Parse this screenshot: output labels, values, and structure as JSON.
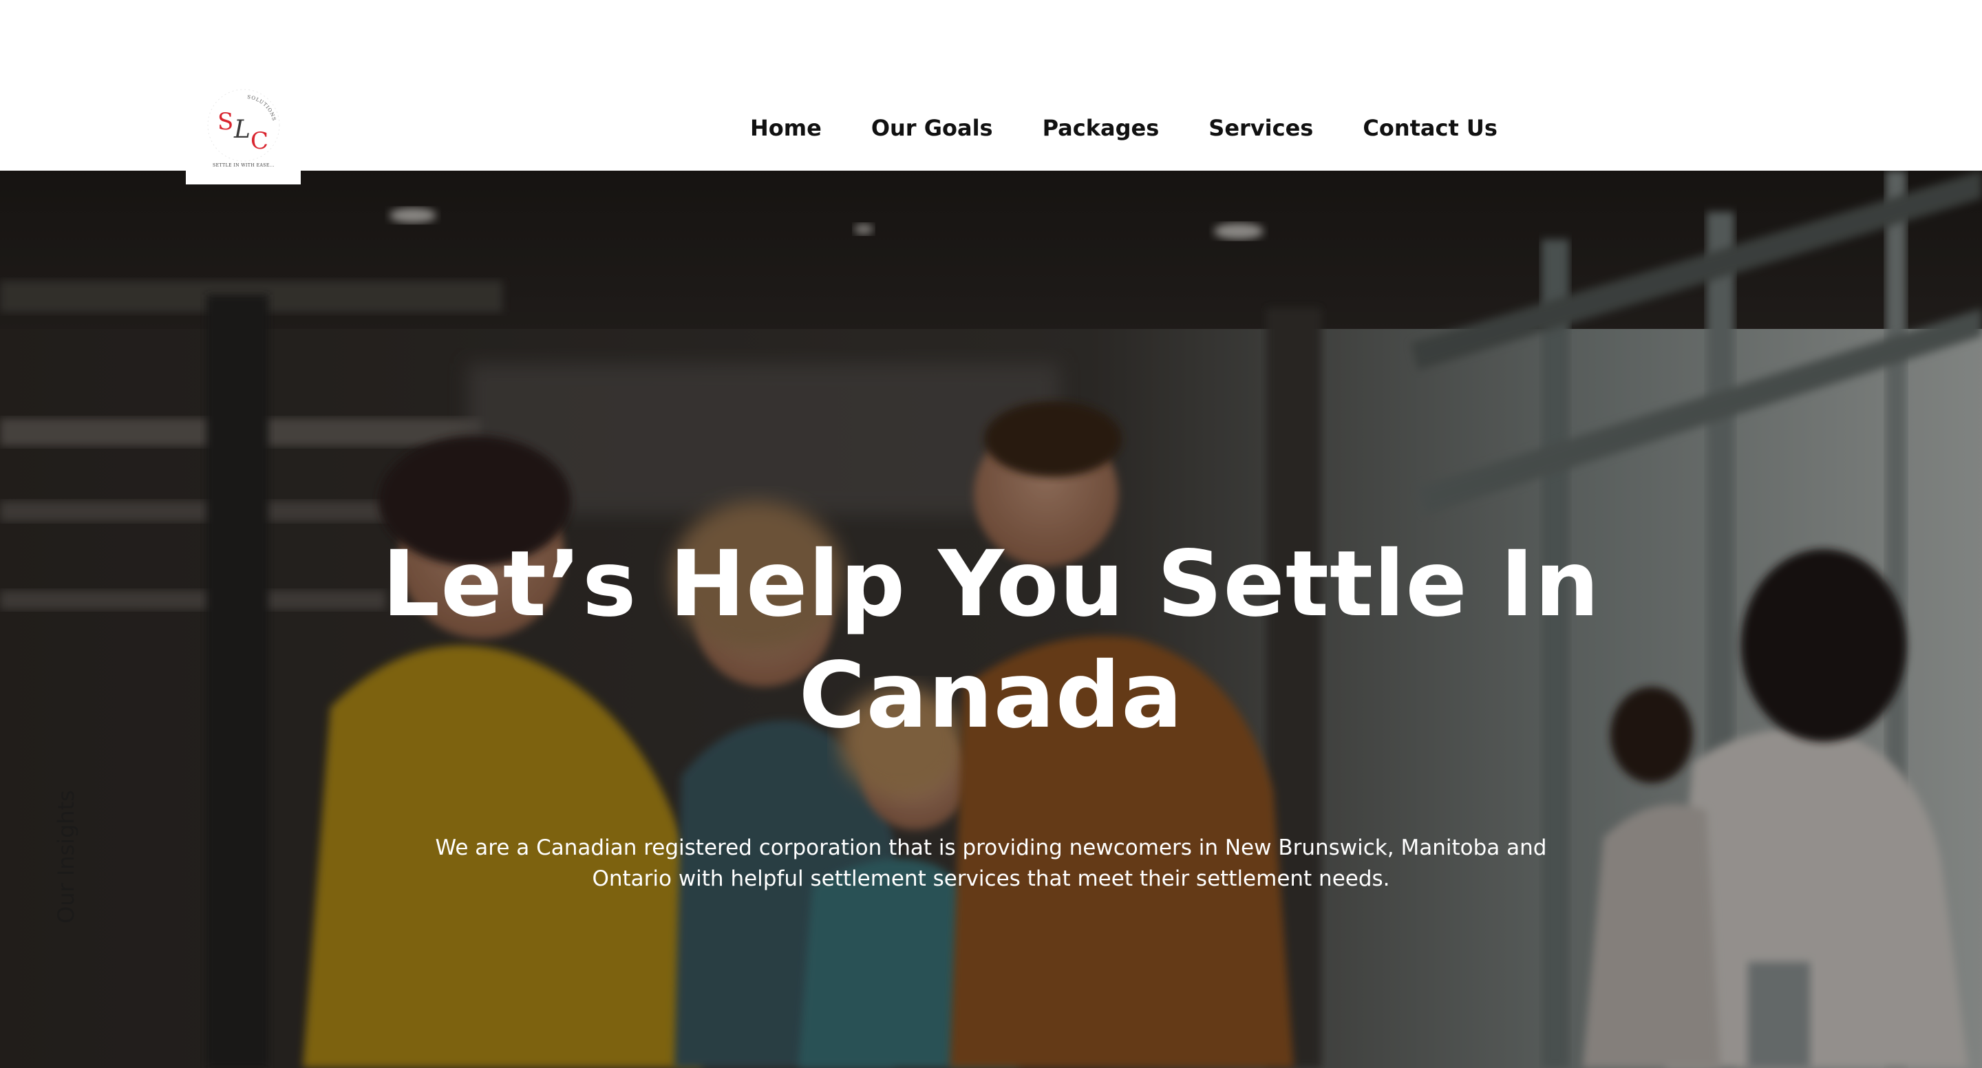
{
  "logo": {
    "letters": [
      "S",
      "L",
      "C"
    ],
    "ring_text_top": "SOLUTIONS",
    "tagline": "SETTLE IN WITH EASE..."
  },
  "nav": {
    "items": [
      {
        "label": "Home"
      },
      {
        "label": "Our Goals"
      },
      {
        "label": "Packages"
      },
      {
        "label": "Services"
      },
      {
        "label": "Contact Us"
      }
    ]
  },
  "hero": {
    "title_line1": "Let’s Help You Settle In",
    "title_line2": "Canada",
    "description_line1": "We are a Canadian registered corporation that is providing newcomers in New Brunswick, Manitoba and",
    "description_line2": "Ontario with helpful settlement services that meet their settlement needs.",
    "side_tab": "Our Insights"
  },
  "colors": {
    "logo_red": "#d9252f",
    "logo_dark": "#3a3a3a",
    "nav_text": "#111111",
    "hero_text": "#ffffff"
  }
}
